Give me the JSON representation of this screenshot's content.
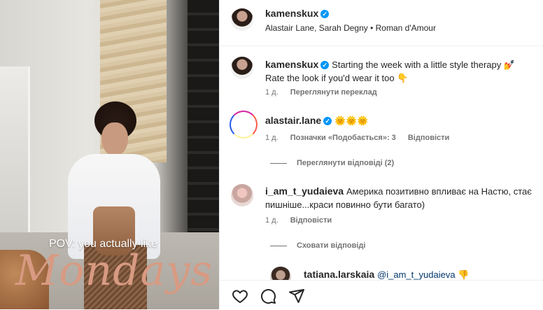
{
  "media": {
    "overlay_line1": "POV: you actually like",
    "overlay_line2": "Mondays"
  },
  "header": {
    "username": "kamenskux",
    "subtitle": "Alastair Lane, Sarah Degny • Roman d'Amour"
  },
  "caption": {
    "username": "kamenskux",
    "text": "Starting the week with a little style therapy 💅 Rate the look if you'd wear it too 👇",
    "time": "1 д.",
    "translate": "Переглянути переклад"
  },
  "comments": [
    {
      "username": "alastair.lane",
      "text": "🌞🌞🌞",
      "time": "1 д.",
      "likes": "Позначки «Подобається»: 3",
      "reply": "Відповісти",
      "thread_toggle": "Переглянути відповіді (2)"
    },
    {
      "username": "i_am_t_yudaieva",
      "text": "Америка позитивно впливає на Настю, стає пишніше...краси повинно бути багато)",
      "time": "1 д.",
      "reply": "Відповісти",
      "thread_toggle": "Сховати відповіді"
    },
    {
      "username": "tatiana.larskaia",
      "text": "@i_am_t_yudaieva 👎"
    }
  ],
  "actions": {
    "like": "heart-icon",
    "comment": "comment-icon",
    "share": "share-icon"
  },
  "colors": {
    "verified": "#0095f6",
    "overlay_script": "#d89a82"
  }
}
